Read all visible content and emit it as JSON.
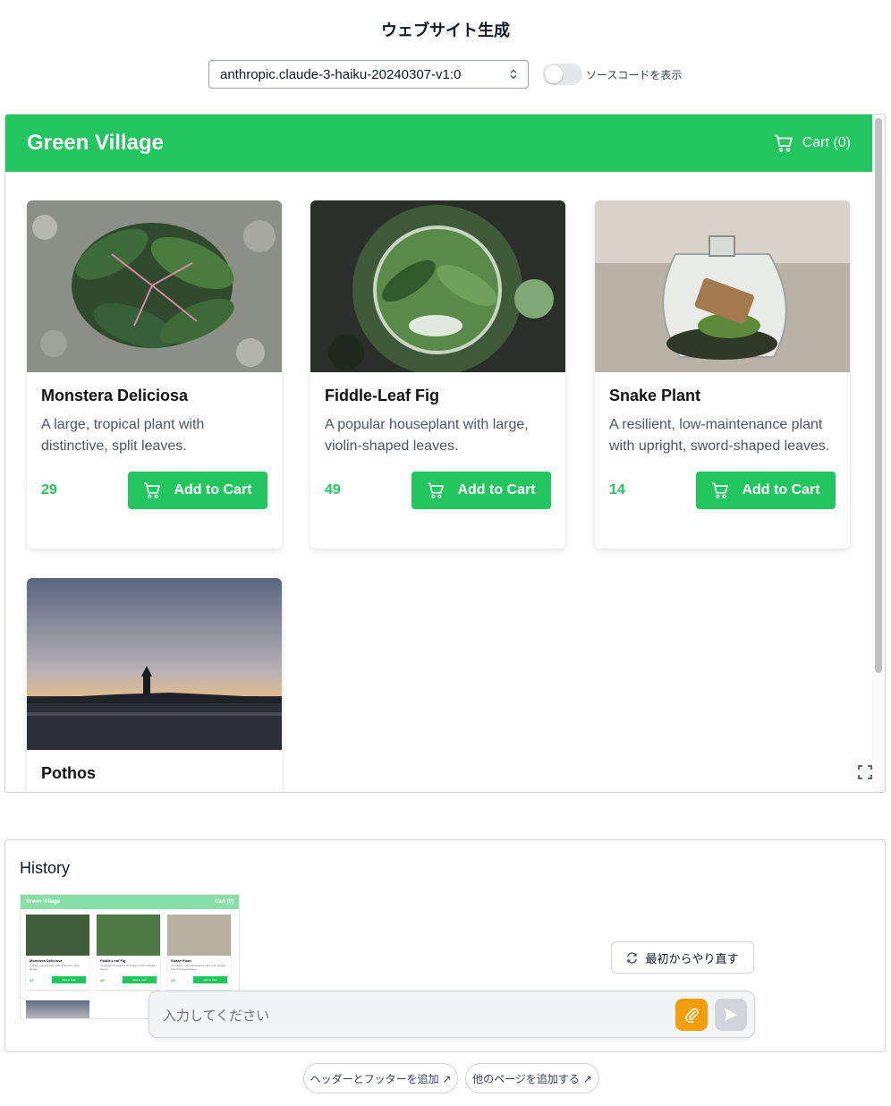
{
  "app": {
    "title": "ウェブサイト生成"
  },
  "controls": {
    "model_value": "anthropic.claude-3-haiku-20240307-v1:0",
    "toggle_label": "ソースコードを表示",
    "toggle_on": false
  },
  "preview": {
    "site_name": "Green Village",
    "cart_label": "Cart (0)",
    "add_label": "Add to Cart",
    "products": [
      {
        "name": "Monstera Deliciosa",
        "description": "A large, tropical plant with distinctive, split leaves.",
        "price": "29"
      },
      {
        "name": "Fiddle-Leaf Fig",
        "description": "A popular houseplant with large, violin-shaped leaves.",
        "price": "49"
      },
      {
        "name": "Snake Plant",
        "description": "A resilient, low-maintenance plant with upright, sword-shaped leaves.",
        "price": "14"
      },
      {
        "name": "Pothos",
        "description": "",
        "price": ""
      }
    ]
  },
  "history": {
    "title": "History",
    "thumbnail": {
      "site_name": "Green Village",
      "cart_label": "Cart (0)",
      "add_label": "Add to Cart",
      "products": [
        {
          "name": "Monstera Deliciosa",
          "description": "A large, tropical plant with distinctive, split leaves.",
          "price": "29"
        },
        {
          "name": "Fiddle-Leaf Fig",
          "description": "A popular houseplant with large, violin-shaped leaves.",
          "price": "49"
        },
        {
          "name": "Snake Plant",
          "description": "A resilient, low-maintenance plant with upright, sword-shaped leaves.",
          "price": "14"
        }
      ]
    }
  },
  "actions": {
    "restart_label": "最初からやり直す",
    "input_placeholder": "入力してください",
    "chip_add_header_footer": "ヘッダーとフッターを追加 ↗",
    "chip_add_pages": "他のページを追加する ↗"
  },
  "colors": {
    "brand_green": "#22c55e",
    "attach_orange": "#f59e0b",
    "send_gray": "#d1d5db"
  }
}
